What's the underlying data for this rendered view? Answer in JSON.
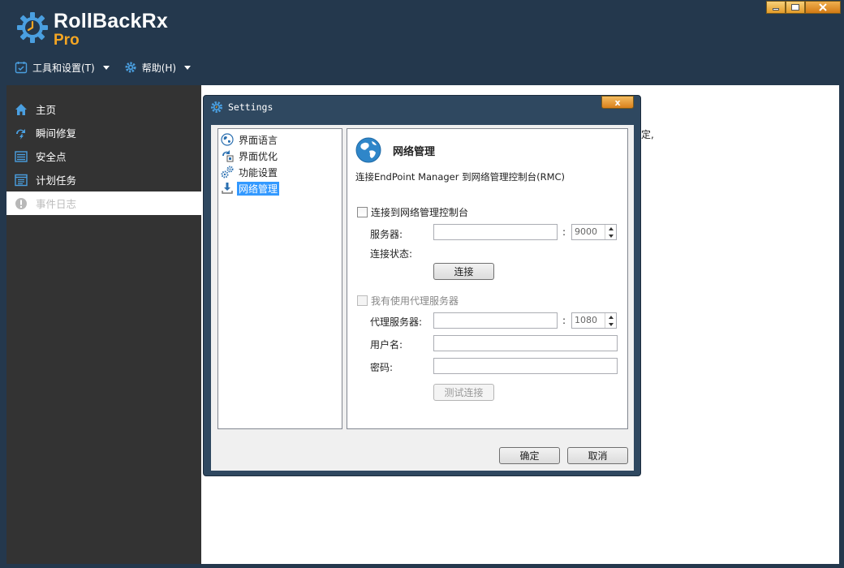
{
  "app": {
    "logo_title": "RollBackRx",
    "logo_sub": "Pro",
    "colors": {
      "header_bg": "#24384d",
      "accent": "#f5a623",
      "sidebar_bg": "#333333",
      "selection": "#3399ff"
    }
  },
  "menubar": {
    "tools": "工具和设置(T)",
    "help": "帮助(H)"
  },
  "sidebar": {
    "items": [
      {
        "label": "主页",
        "icon": "home-icon"
      },
      {
        "label": "瞬间修复",
        "icon": "lightning-icon"
      },
      {
        "label": "安全点",
        "icon": "list-icon"
      },
      {
        "label": "计划任务",
        "icon": "schedule-icon"
      },
      {
        "label": "事件日志",
        "icon": "alert-icon"
      }
    ]
  },
  "main": {
    "partial_text": "定,"
  },
  "dialog": {
    "title": "Settings",
    "close_label": "x",
    "tree": [
      {
        "label": "界面语言",
        "icon": "globe-icon"
      },
      {
        "label": "界面优化",
        "icon": "optimize-icon"
      },
      {
        "label": "功能设置",
        "icon": "gears-icon"
      },
      {
        "label": "网络管理",
        "icon": "download-icon"
      }
    ],
    "panel": {
      "title": "网络管理",
      "description": "连接EndPoint Manager 到网络管理控制台(RMC)",
      "connect_checkbox": "连接到网络管理控制台",
      "server_label": "服务器:",
      "server_value": "",
      "colon": ":",
      "server_port": "9000",
      "status_label": "连接状态:",
      "connect_button": "连接",
      "proxy_checkbox": "我有使用代理服务器",
      "proxy_label": "代理服务器:",
      "proxy_value": "",
      "proxy_port": "1080",
      "username_label": "用户名:",
      "username_value": "",
      "password_label": "密码:",
      "password_value": "",
      "test_button": "测试连接"
    },
    "ok_button": "确定",
    "cancel_button": "取消"
  }
}
